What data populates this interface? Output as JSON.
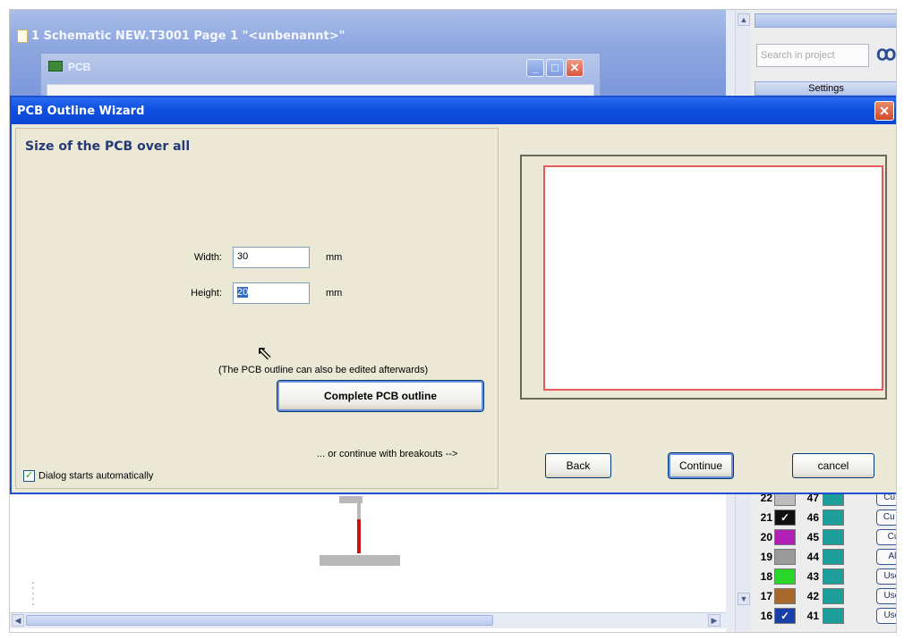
{
  "background_window": {
    "title": "1 Schematic NEW.T3001 Page 1 \"<unbenannt>\"",
    "pcb_window_title": "PCB"
  },
  "right_panel": {
    "search_placeholder": "Search in project",
    "settings_label": "Settings",
    "layers": [
      {
        "left_num": "22",
        "left_color": "#bdbdbd",
        "left_checked": false,
        "right_num": "47",
        "right_color": "#1e9e9a",
        "button": "Cu T"
      },
      {
        "left_num": "21",
        "left_color": "#111111",
        "left_checked": true,
        "right_num": "46",
        "right_color": "#1e9e9a",
        "button": "Cu B"
      },
      {
        "left_num": "20",
        "left_color": "#b21fb5",
        "left_checked": false,
        "right_num": "45",
        "right_color": "#1e9e9a",
        "button": "Cu"
      },
      {
        "left_num": "19",
        "left_color": "#9a9a9a",
        "left_checked": false,
        "right_num": "44",
        "right_color": "#1e9e9a",
        "button": "All"
      },
      {
        "left_num": "18",
        "left_color": "#29d629",
        "left_checked": false,
        "right_num": "43",
        "right_color": "#1e9e9a",
        "button": "User"
      },
      {
        "left_num": "17",
        "left_color": "#a8692a",
        "left_checked": false,
        "right_num": "42",
        "right_color": "#1e9e9a",
        "button": "User"
      },
      {
        "left_num": "16",
        "left_color": "#1b3fa8",
        "left_checked": true,
        "right_num": "41",
        "right_color": "#1e9e9a",
        "button": "User"
      }
    ]
  },
  "dialog": {
    "title": "PCB Outline Wizard",
    "heading": "Size of the PCB over all",
    "width_label": "Width:",
    "width_value": "30",
    "width_unit": "mm",
    "height_label": "Height:",
    "height_value": "20",
    "height_unit": "mm",
    "note": "(The PCB outline can also be edited afterwards)",
    "complete_button": "Complete PCB outline",
    "breakouts_text": "... or continue with breakouts -->",
    "auto_start_checkbox": "Dialog starts automatically",
    "auto_start_checked": true,
    "back_button": "Back",
    "continue_button": "Continue",
    "cancel_button": "cancel"
  },
  "colors": {
    "titlebar_blue": "#0f4fe0",
    "outline_red": "#e55a5a",
    "heading_blue": "#253a75"
  }
}
